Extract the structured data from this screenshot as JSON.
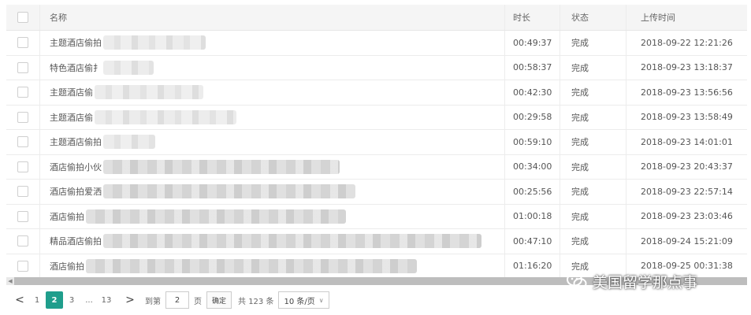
{
  "table": {
    "headers": {
      "name": "名称",
      "duration": "时长",
      "status": "状态",
      "upload_time": "上传时间"
    },
    "rows": [
      {
        "name": "主题酒店偷拍",
        "duration": "00:49:37",
        "status": "完成",
        "upload_time": "2018-09-22 12:21:26"
      },
      {
        "name": "特色酒店偷扌",
        "duration": "00:58:37",
        "status": "完成",
        "upload_time": "2018-09-23 13:18:37"
      },
      {
        "name": "主题酒店偷",
        "duration": "00:42:30",
        "status": "完成",
        "upload_time": "2018-09-23 13:56:56"
      },
      {
        "name": "主题酒店偷",
        "duration": "00:29:58",
        "status": "完成",
        "upload_time": "2018-09-23 13:58:49"
      },
      {
        "name": "主题酒店偷拍",
        "duration": "00:59:10",
        "status": "完成",
        "upload_time": "2018-09-23 14:01:01"
      },
      {
        "name": "酒店偷拍小伙",
        "duration": "00:34:00",
        "status": "完成",
        "upload_time": "2018-09-23 20:43:37"
      },
      {
        "name": "酒店偷拍爱洒",
        "duration": "00:25:56",
        "status": "完成",
        "upload_time": "2018-09-23 22:57:14"
      },
      {
        "name": "酒店偷拍",
        "duration": "01:00:18",
        "status": "完成",
        "upload_time": "2018-09-23 23:03:46"
      },
      {
        "name": "精品酒店偷拍",
        "duration": "00:47:10",
        "status": "完成",
        "upload_time": "2018-09-24 15:21:09"
      },
      {
        "name": "酒店偷拍",
        "duration": "01:16:20",
        "status": "完成",
        "upload_time": "2018-09-25 00:31:38"
      }
    ]
  },
  "pagination": {
    "prev_symbol": "<",
    "next_symbol": ">",
    "pages": [
      "1",
      "2",
      "3",
      "...",
      "13"
    ],
    "current_page": "2",
    "goto_label": "到第",
    "goto_value": "2",
    "page_unit": "页",
    "confirm_label": "确定",
    "total_label": "共 123 条",
    "page_size_label": "10 条/页"
  },
  "watermark": {
    "text": "美国留学那点事"
  },
  "colors": {
    "accent": "#1f9e8c",
    "header_bg": "#f5f5f5",
    "scrollbar": "#bdbdbd"
  }
}
